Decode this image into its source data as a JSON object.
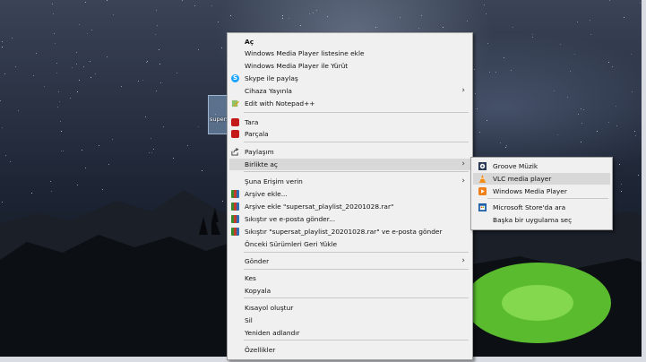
{
  "desktop": {
    "icon_label": "supersat_playlist_2"
  },
  "context_menu": {
    "items": [
      {
        "label": "Aç",
        "bold": true
      },
      {
        "label": "Windows Media Player listesine ekle"
      },
      {
        "label": "Windows Media Player ile Yürüt"
      },
      {
        "label": "Skype ile paylaş",
        "icon": "skype-icon"
      },
      {
        "label": "Cihaza Yayınla",
        "submenu": true
      },
      {
        "label": "Edit with Notepad++",
        "icon": "notepad-plus-plus-icon"
      },
      {
        "label": "Tara",
        "icon": "mcafee-icon"
      },
      {
        "label": "Parçala",
        "icon": "mcafee-icon"
      },
      {
        "label": "Paylaşım",
        "icon": "share-icon"
      },
      {
        "label": "Birlikte aç",
        "submenu": true
      },
      {
        "label": "Şuna Erişim verin",
        "submenu": true
      },
      {
        "label": "Arşive ekle...",
        "icon": "winrar-icon"
      },
      {
        "label": "Arşive ekle \"supersat_playlist_20201028.rar\"",
        "icon": "winrar-icon"
      },
      {
        "label": "Sıkıştır ve e-posta gönder...",
        "icon": "winrar-icon"
      },
      {
        "label": "Sıkıştır \"supersat_playlist_20201028.rar\" ve e-posta gönder",
        "icon": "winrar-icon"
      },
      {
        "label": "Önceki Sürümleri Geri Yükle"
      },
      {
        "label": "Gönder",
        "submenu": true
      },
      {
        "label": "Kes"
      },
      {
        "label": "Kopyala"
      },
      {
        "label": "Kısayol oluştur"
      },
      {
        "label": "Sil"
      },
      {
        "label": "Yeniden adlandır"
      },
      {
        "label": "Özellikler"
      }
    ]
  },
  "open_with_submenu": {
    "items": [
      {
        "label": "Groove Müzik",
        "icon": "groove-music-icon"
      },
      {
        "label": "VLC media player",
        "icon": "vlc-icon"
      },
      {
        "label": "Windows Media Player",
        "icon": "windows-media-player-icon"
      },
      {
        "label": "Microsoft Store'da ara",
        "icon": "microsoft-store-icon"
      },
      {
        "label": "Başka bir uygulama seç"
      }
    ]
  },
  "colors": {
    "menu_bg": "#f0f0f0",
    "highlight": "#d8d8d8",
    "tent_green": "#6fd13a"
  }
}
